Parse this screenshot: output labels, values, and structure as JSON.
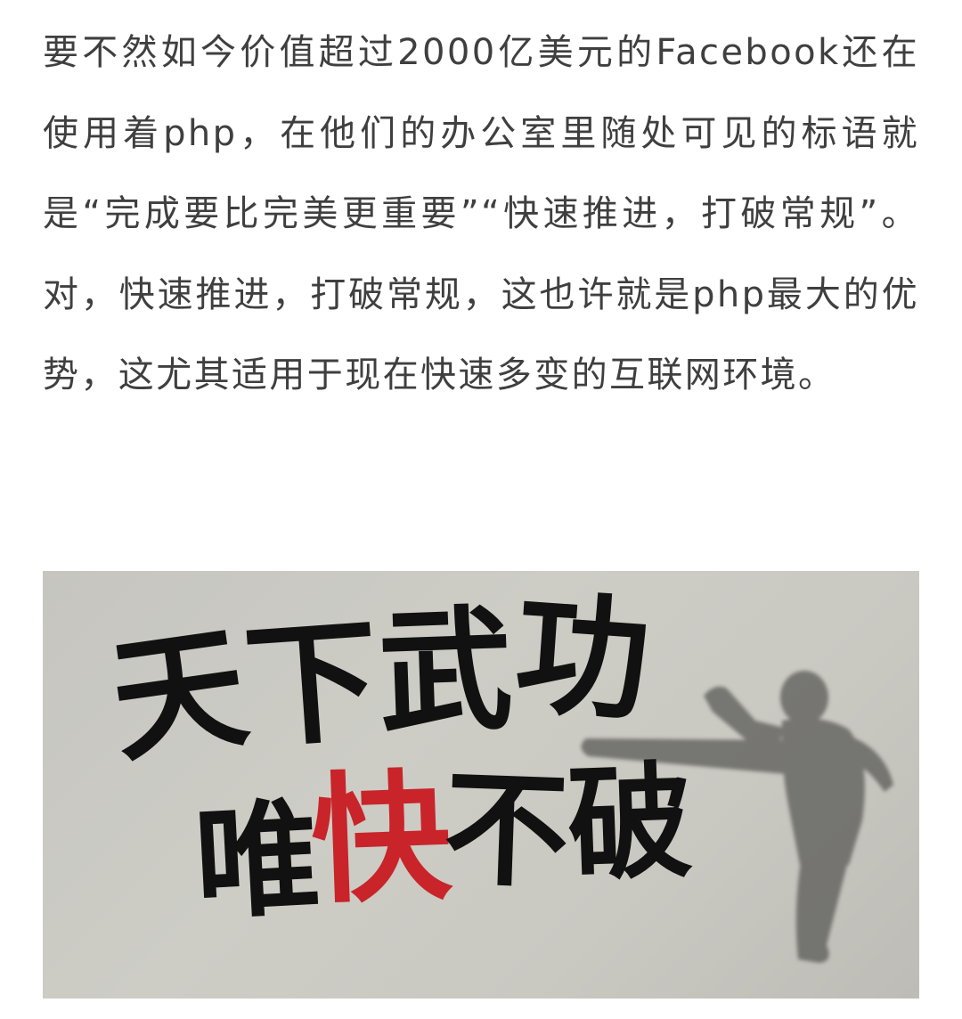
{
  "article": {
    "paragraph": "要不然如今价值超过2000亿美元的Facebook还在使用着php，在他们的办公室里随处可见的标语就是“完成要比完美更重要”“快速推进，打破常规”。对，快速推进，打破常规，这也许就是php最大的优势，这尤其适用于现在快速多变的互联网环境。"
  },
  "figure": {
    "line1": [
      "天",
      "下",
      "武",
      "功"
    ],
    "line2": [
      "唯",
      "快",
      "不",
      "破"
    ],
    "accent_color": "#c8242a",
    "ink_color": "#111111",
    "background_color": "#c9c8c1",
    "silhouette": "kicking-martial-artist-silhouette"
  }
}
